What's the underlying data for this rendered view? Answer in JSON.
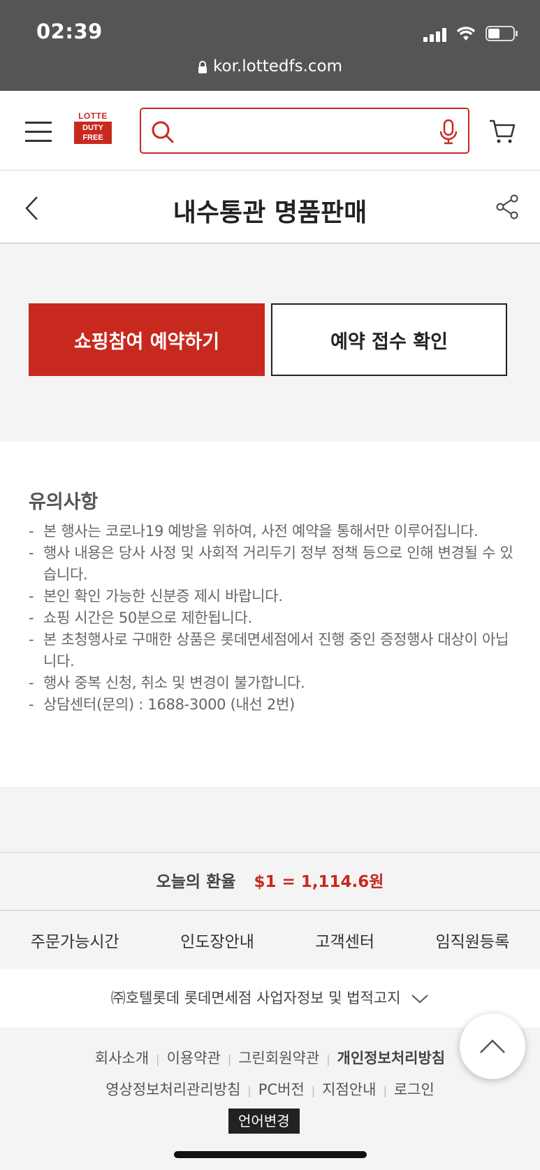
{
  "status": {
    "time": "02:39",
    "url": "kor.lottedfs.com"
  },
  "header": {
    "logo_top": "LOTTE",
    "logo_line1": "DUTY",
    "logo_line2": "FREE",
    "search_placeholder": ""
  },
  "titlebar": {
    "title": "내수통관 명품판매"
  },
  "actions": {
    "reserve_label": "쇼핑참여 예약하기",
    "confirm_label": "예약 접수 확인"
  },
  "notice": {
    "heading": "유의사항",
    "items": [
      "본 행사는 코로나19 예방을 위하여, 사전 예약을 통해서만 이루어집니다.",
      "행사 내용은 당사 사정 및 사회적 거리두기 정부 정책 등으로 인해 변경될 수 있습니다.",
      "본인 확인 가능한 신분증 제시 바랍니다.",
      "쇼핑 시간은 50분으로 제한됩니다.",
      "본 초청행사로 구매한 상품은 롯데면세점에서 진행 중인 증정행사 대상이 아닙니다.",
      "행사 중복 신청, 취소 및 변경이 불가합니다.",
      "상담센터(문의) : 1688-3000 (내선 2번)"
    ]
  },
  "rate": {
    "label": "오늘의 환율",
    "value": "$1 = 1,114.6원"
  },
  "links": [
    "주문가능시간",
    "인도장안내",
    "고객센터",
    "임직원등록"
  ],
  "company": {
    "label": "㈜호텔롯데 롯데면세점 사업자정보 및 법적고지"
  },
  "footer": {
    "row1": [
      "회사소개",
      "이용약관",
      "그린회원약관",
      "개인정보처리방침"
    ],
    "row2": [
      "영상정보처리관리방침",
      "PC버전",
      "지점안내",
      "로그인"
    ],
    "language": "언어변경"
  },
  "colors": {
    "brand_red": "#c8291f",
    "status_bar": "#555555"
  },
  "icons": [
    "hamburger-icon",
    "search-icon",
    "mic-icon",
    "cart-icon",
    "back-icon",
    "share-icon",
    "chevron-down-icon",
    "arrow-up-icon"
  ]
}
